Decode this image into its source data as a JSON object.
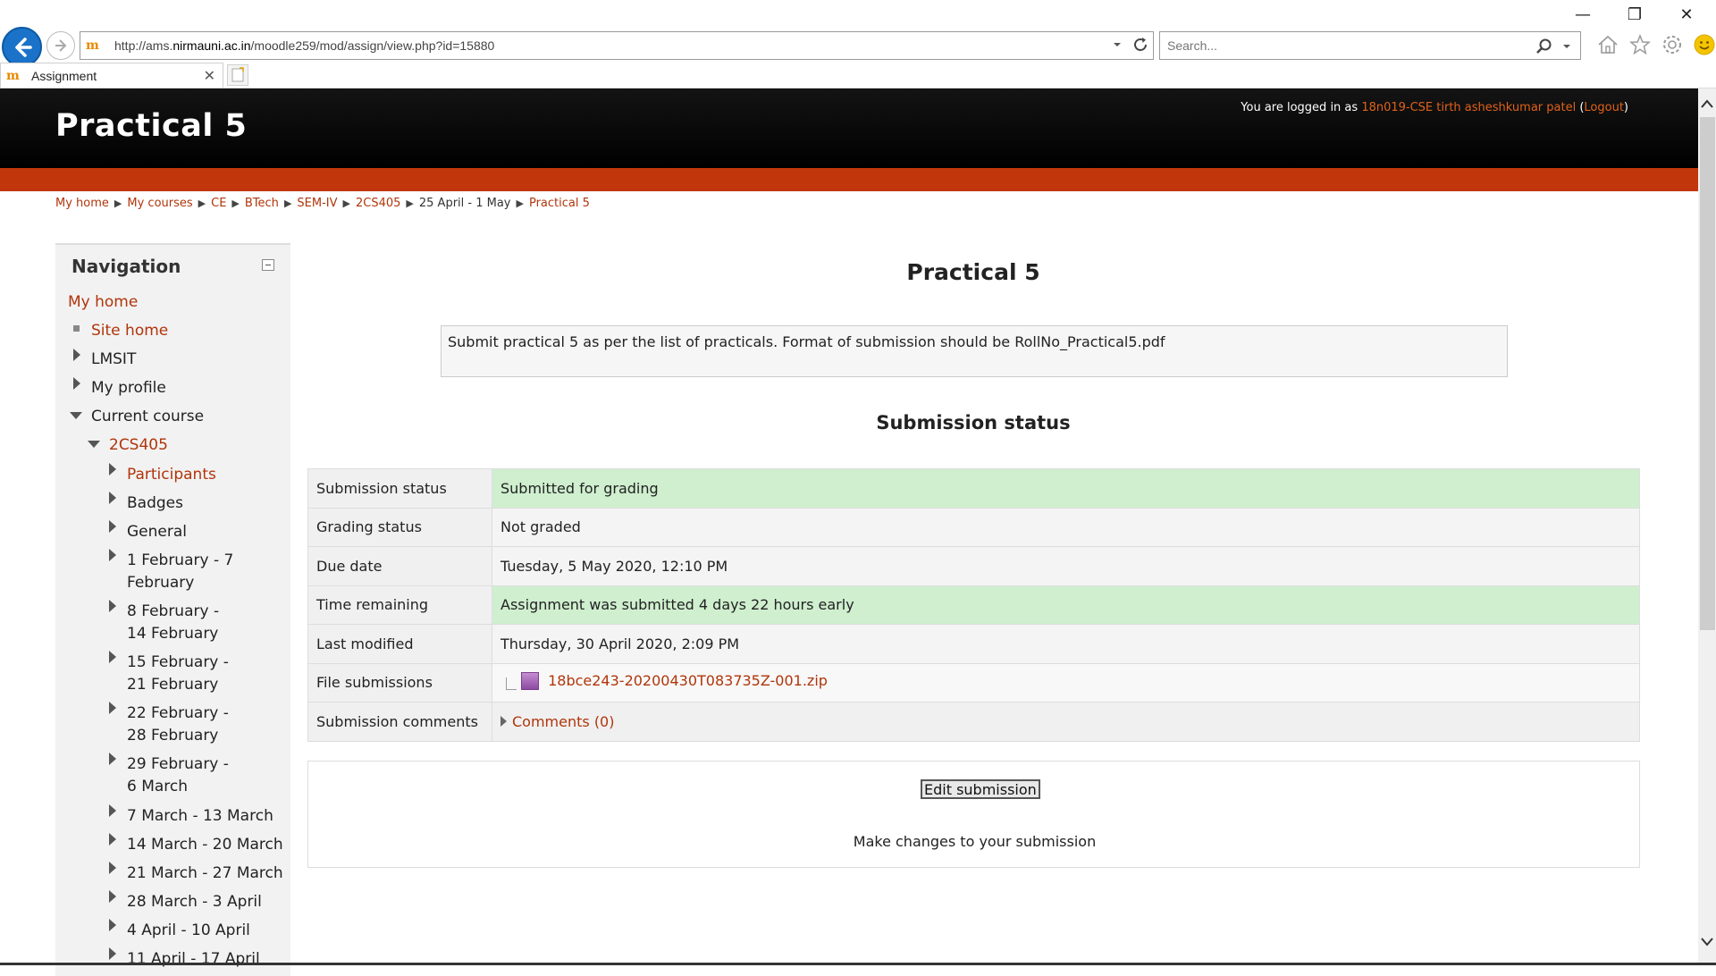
{
  "browser": {
    "url_prefix": "http://ams.",
    "url_domain": "nirmauni.ac.in",
    "url_path": "/moodle259/mod/assign/view.php?id=15880",
    "search_placeholder": "Search...",
    "tab_title": "Assignment",
    "favicon_text": "m"
  },
  "header": {
    "title": "Practical 5",
    "login_prefix": "You are logged in as",
    "user_name": "18n019-CSE tirth asheshkumar patel",
    "logout_label": "Logout"
  },
  "breadcrumb": {
    "items": [
      "My home",
      "My courses",
      "CE",
      "BTech",
      "SEM-IV",
      "2CS405",
      "25 April - 1 May",
      "Practical 5"
    ],
    "separator": "▶"
  },
  "navigation": {
    "title": "Navigation",
    "items": [
      {
        "label": "My home"
      },
      {
        "label": "Site home"
      },
      {
        "label": "LMSIT"
      },
      {
        "label": "My profile"
      },
      {
        "label": "Current course"
      },
      {
        "label": "2CS405"
      },
      {
        "label": "Participants"
      },
      {
        "label": "Badges"
      },
      {
        "label": "General"
      },
      {
        "label": "1 February - 7 February"
      },
      {
        "label": "8 February - 14 February"
      },
      {
        "label": "15 February - 21 February"
      },
      {
        "label": "22 February - 28 February"
      },
      {
        "label": "29 February - 6 March"
      },
      {
        "label": "7 March - 13 March"
      },
      {
        "label": "14 March - 20 March"
      },
      {
        "label": "21 March - 27 March"
      },
      {
        "label": "28 March - 3 April"
      },
      {
        "label": "4 April - 10 April"
      },
      {
        "label": "11 April - 17 April"
      }
    ]
  },
  "main": {
    "title": "Practical 5",
    "intro": "Submit practical 5 as per the list of practicals. Format of submission should be RollNo_Practical5.pdf",
    "status_heading": "Submission status",
    "rows": [
      {
        "label": "Submission status",
        "value": "Submitted for grading"
      },
      {
        "label": "Grading status",
        "value": "Not graded"
      },
      {
        "label": "Due date",
        "value": "Tuesday, 5 May 2020, 12:10 PM"
      },
      {
        "label": "Time remaining",
        "value": "Assignment was submitted 4 days 22 hours early"
      },
      {
        "label": "Last modified",
        "value": "Thursday, 30 April 2020, 2:09 PM"
      },
      {
        "label": "File submissions",
        "value": "18bce243-20200430T083735Z-001.zip"
      },
      {
        "label": "Submission comments",
        "value": "Comments (0)"
      }
    ],
    "edit_button": "Edit submission",
    "edit_description": "Make changes to your submission"
  },
  "colors": {
    "accent": "#c1360b",
    "link": "#b0350b",
    "success_bg": "#cfefcf",
    "header_bg": "#000000"
  }
}
